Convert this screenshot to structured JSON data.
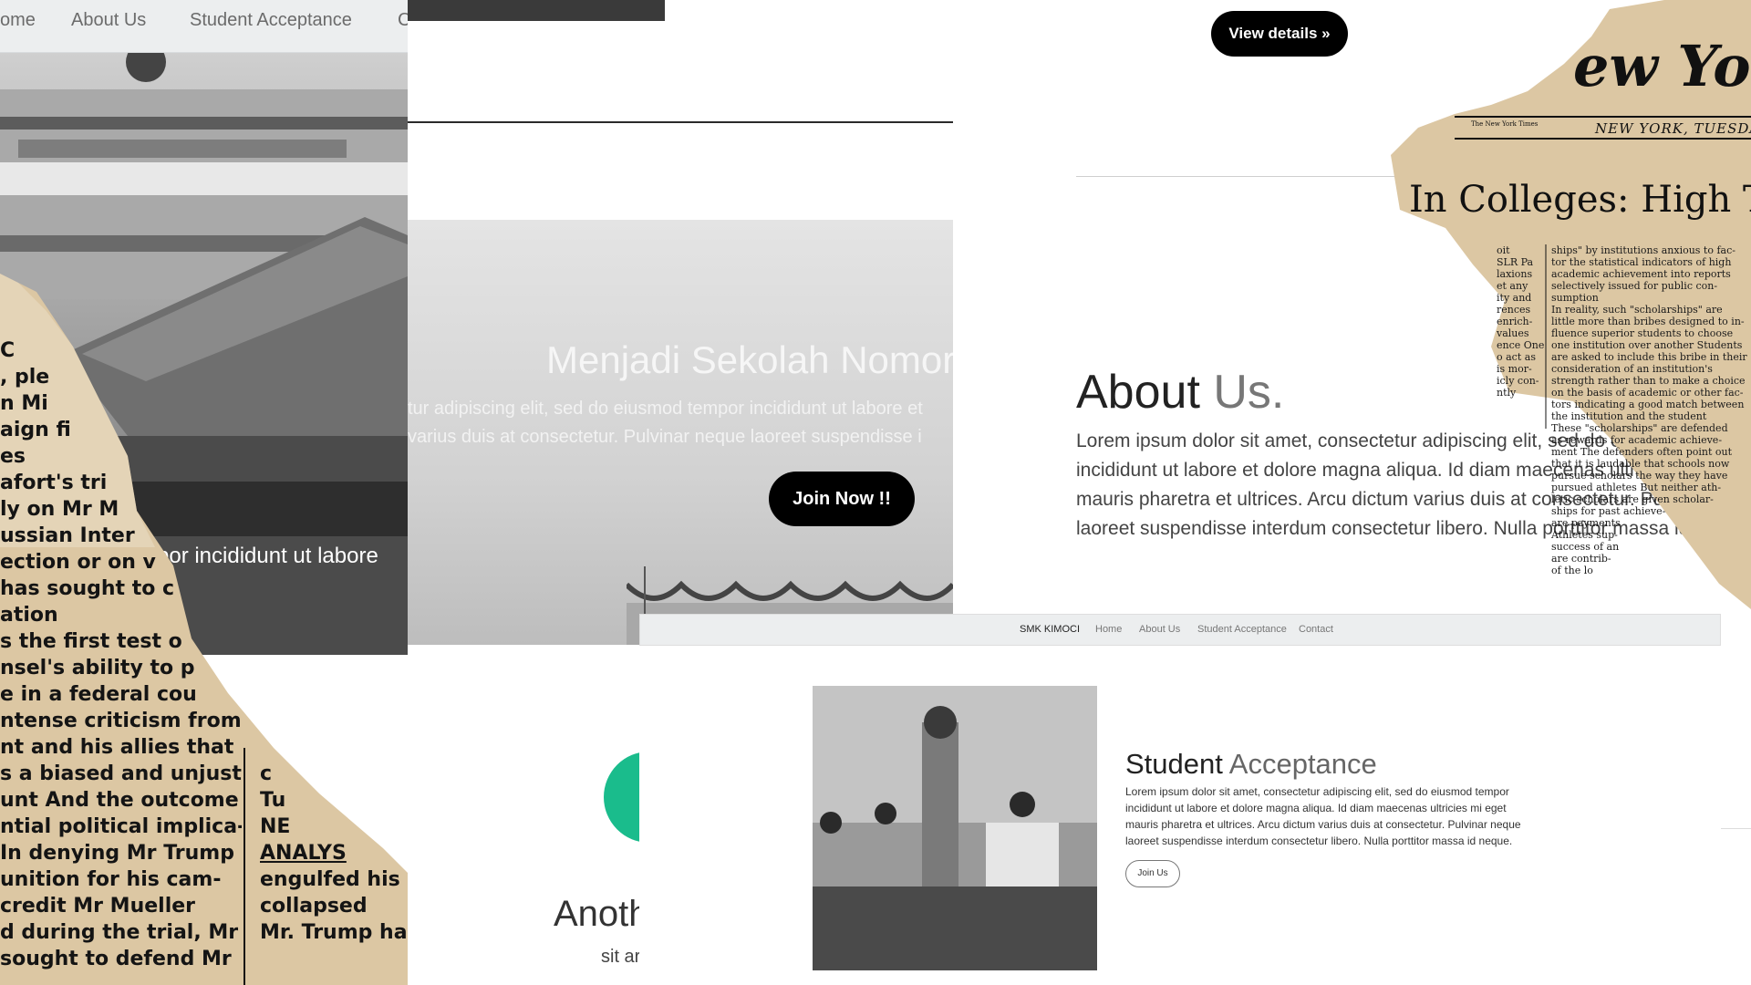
{
  "colors": {
    "nav_bg": "#eceeef",
    "button_dark": "#000000",
    "accent_green": "#1abc8c",
    "newspaper_tan": "#dcc7a3"
  },
  "panel1": {
    "nav": [
      "ome",
      "About Us",
      "Student Acceptance",
      "C"
    ],
    "caption": "mpor incididunt ut labore"
  },
  "news_left": {
    "lines": [
      "C",
      ", ple",
      "n Mi",
      "aign fi",
      "es",
      "afort's  tri",
      "ly on Mr M",
      "ussian Inter",
      "ection  or  on  v",
      "has sought to c",
      "ation",
      "s  the first test o",
      "nsel's  ability  to  p",
      "e  in  a  federal  cou",
      "ntense criticism from",
      "nt  and  his  allies  that",
      "s a biased and unjustu-",
      "unt  And the outcome",
      "ntial  political  implica-",
      " In denying Mr Trump",
      "unition  for  his  cam-",
      "credit  Mr  Mueller",
      "d  during  the  trial,  Mr",
      "sought to defend Mr"
    ],
    "right_lines": [
      "c",
      "Tu",
      "NE",
      "ANALYS",
      "",
      "engulfed his Wh",
      "collapsed",
      "  Mr. Trump has long"
    ]
  },
  "panel2": {
    "title": "Menjadi Sekolah Nomor",
    "line1": "tur adipiscing elit, sed do eiusmod tempor incididunt ut labore et",
    "line2": "varius duis at consectetur. Pulvinar neque laoreet suspendisse i",
    "button": "Join Now !!"
  },
  "panel3": {
    "title": "Anoth",
    "text": "sit ar"
  },
  "panel4": {
    "button": "View details »",
    "heading_dark": "About",
    "heading_light": "Us.",
    "paragraph": [
      "Lorem ipsum dolor sit amet, consectetur adipiscing elit, sed do eiusmod tempor",
      "incididunt ut labore et dolore magna aliqua. Id diam maecenas ultricies mi eget",
      "mauris pharetra et ultrices. Arcu dictum varius duis at consectetur. Pulvinar neque",
      "laoreet suspendisse interdum consectetur libero. Nulla porttitor massa id neque."
    ]
  },
  "news_right": {
    "masthead": "ew Yo",
    "small": "The New York Times",
    "dateline": "NEW YORK, TUESDAY,",
    "headline": "In Colleges: High T",
    "sidebar": [
      "oit",
      "",
      "SLR Pa",
      "laxions",
      "et any",
      "ity and",
      "rences",
      "enrich-",
      "values",
      "ence  One",
      "o act as",
      "is mor-",
      "icly con-",
      "ntly"
    ],
    "column": [
      "ships\" by institutions anxious to fac-",
      "tor the statistical indicators of high",
      "academic achievement into reports",
      "selectively issued for public con-",
      "sumption",
      "  In reality, such \"scholarships\" are",
      "little more than bribes designed to in-",
      "fluence superior students to choose",
      "one institution over another Students",
      "are asked to include this bribe in their",
      "consideration of an institution's",
      "strength rather than to make a choice",
      "on the basis of academic or other fac-",
      "tors indicating a good match between",
      "the institution and the student",
      "  These \"scholarships\" are defended",
      "as rewards for academic achieve-",
      "ment  The defenders often point out",
      "that it is laudable that schools now",
      "pursue scholars the way they have",
      "pursued athletes  But neither ath-",
      "letic scholars are given scholar-",
      "ships for past achieve-",
      "are payments",
      "Athletes sup-",
      "success of an",
      "are contrib-",
      "of the lo"
    ]
  },
  "panel5": {
    "nav": {
      "brand": "SMK KIMOCI",
      "items": [
        "Home",
        "About Us",
        "Student Acceptance",
        "Contact"
      ]
    },
    "heading_dark": "Student",
    "heading_light": "Acceptance",
    "paragraph": [
      "Lorem ipsum dolor sit amet, consectetur adipiscing elit, sed do eiusmod tempor",
      "incididunt ut labore et dolore magna aliqua. Id diam maecenas ultricies mi eget",
      "mauris pharetra et ultrices. Arcu dictum varius duis at consectetur. Pulvinar neque",
      "laoreet suspendisse interdum consectetur libero. Nulla porttitor massa id neque."
    ],
    "button": "Join Us"
  }
}
